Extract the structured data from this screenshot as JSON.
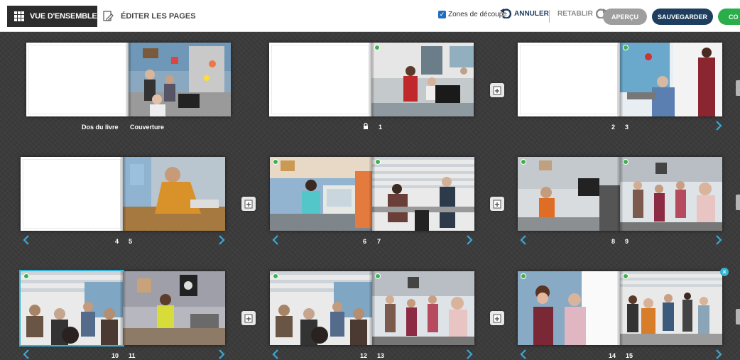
{
  "toolbar": {
    "overview_tab": "VUE D'ENSEMBLE",
    "edit_tab": "ÉDITER LES PAGES",
    "crop_zones_label": "Zones de découpe",
    "crop_zones_checked": true,
    "undo_label": "ANNULER",
    "redo_label": "RETABLIR",
    "preview_label": "APERÇU",
    "save_label": "SAUVEGARDER",
    "order_label": "CO"
  },
  "spreads": [
    {
      "left_label": "Dos du livre",
      "right_label": "Couverture"
    },
    {
      "left_label": "",
      "right_label": "1",
      "locked": true
    },
    {
      "left_label": "2",
      "right_label": "3"
    },
    {
      "left_label": "4",
      "right_label": "5"
    },
    {
      "left_label": "6",
      "right_label": "7"
    },
    {
      "left_label": "8",
      "right_label": "9"
    },
    {
      "left_label": "10",
      "right_label": "11",
      "selected": true
    },
    {
      "left_label": "12",
      "right_label": "13"
    },
    {
      "left_label": "14",
      "right_label": "15"
    }
  ],
  "colors": {
    "accent_blue": "#1e6fbf",
    "navy": "#1d3e5e",
    "green": "#29ae4a",
    "selection": "#35b5d4",
    "nav_arrow": "#3aa7d6"
  },
  "icons": {
    "grid": "grid-icon",
    "edit": "edit-pages-icon",
    "undo": "undo-arrow-icon",
    "redo": "redo-arrow-icon",
    "lock": "lock-icon",
    "add_page": "add-page-icon",
    "prev": "chevron-left-icon",
    "next": "chevron-right-icon"
  }
}
